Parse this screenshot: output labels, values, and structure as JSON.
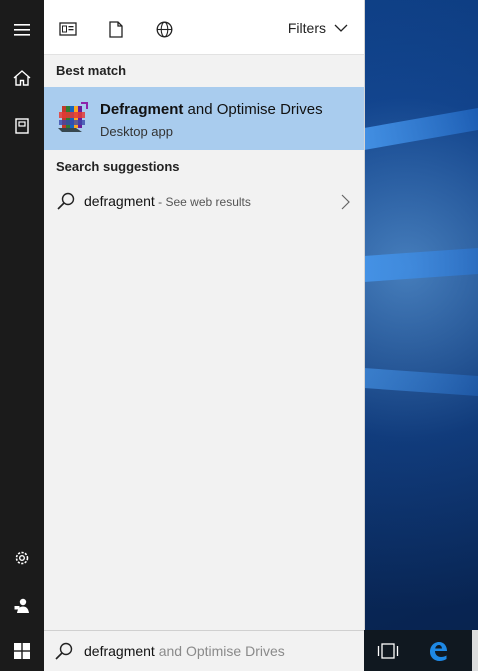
{
  "scopes": [
    {
      "icon": "apps-icon"
    },
    {
      "icon": "documents-icon"
    },
    {
      "icon": "web-icon"
    }
  ],
  "filters_label": "Filters",
  "best_match": {
    "section_title": "Best match",
    "title_bold": "Defragment",
    "title_rest": " and Optimise Drives",
    "subtitle": "Desktop app",
    "icon": "defrag-app-icon"
  },
  "suggestions": {
    "section_title": "Search suggestions",
    "items": [
      {
        "query": "defragment",
        "suffix": " - See web results"
      }
    ]
  },
  "search_box": {
    "typed": "defragment",
    "autocomplete": " and Optimise Drives"
  },
  "rail": [
    "hamburger-icon",
    "home-icon",
    "notebook-icon",
    "settings-icon",
    "feedback-icon"
  ],
  "taskbar": [
    "start-icon",
    "task-view-icon",
    "edge-icon"
  ],
  "colors": {
    "selection": "#a9ccee",
    "rail": "#1b1b1b",
    "panel": "#f2f2f2",
    "edge_blue": "#1e88e5"
  }
}
